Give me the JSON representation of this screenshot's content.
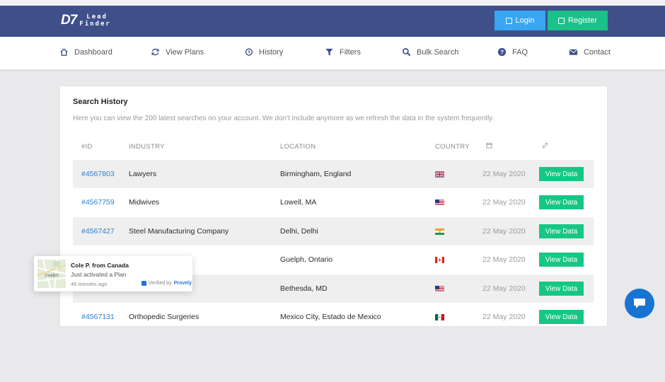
{
  "brand": {
    "mark": "D7",
    "line1": "Lead",
    "line2": "Finder"
  },
  "header": {
    "login_label": "Login",
    "register_label": "Register"
  },
  "nav": {
    "items": [
      {
        "label": "Dashboard",
        "icon": "home-icon"
      },
      {
        "label": "View Plans",
        "icon": "refresh-icon"
      },
      {
        "label": "History",
        "icon": "history-icon"
      },
      {
        "label": "Filters",
        "icon": "filter-icon"
      },
      {
        "label": "Bulk Search",
        "icon": "search-icon"
      },
      {
        "label": "FAQ",
        "icon": "question-icon"
      },
      {
        "label": "Contact",
        "icon": "mail-icon"
      }
    ]
  },
  "card": {
    "title": "Search History",
    "subtitle": "Here you can view the 200 latest searches on your account. We don't include anymore as we refresh the data in the system frequently."
  },
  "table": {
    "headers": {
      "id": "#ID",
      "industry": "INDUSTRY",
      "location": "LOCATION",
      "country": "COUNTRY",
      "date_icon": "calendar-icon",
      "link_icon": "link-icon"
    },
    "rows": [
      {
        "id": "#4567803",
        "industry": "Lawyers",
        "location": "Birmingham, England",
        "country": "uk-flag",
        "date": "22 May 2020",
        "action": "View Data"
      },
      {
        "id": "#4567759",
        "industry": "Midwives",
        "location": "Lowell, MA",
        "country": "us-flag",
        "date": "22 May 2020",
        "action": "View Data"
      },
      {
        "id": "#4567427",
        "industry": "Steel Manufacturing Company",
        "location": "Delhi, Delhi",
        "country": "india-flag",
        "date": "22 May 2020",
        "action": "View Data"
      },
      {
        "id": "",
        "industry": "",
        "location": "Guelph, Ontario",
        "country": "canada-flag",
        "date": "22 May 2020",
        "action": "View Data"
      },
      {
        "id": "",
        "industry": "",
        "location": "Bethesda, MD",
        "country": "us-flag",
        "date": "22 May 2020",
        "action": "View Data"
      },
      {
        "id": "#4567131",
        "industry": "Orthopedic Surgeries",
        "location": "Mexico City, Estado de Mexico",
        "country": "mexico-flag",
        "date": "22 May 2020",
        "action": "View Data"
      }
    ]
  },
  "popup": {
    "map_label": "Guelph",
    "title": "Cole P. from Canada",
    "message": "Just activated a Plan",
    "time": "46 minutes ago",
    "verified_by": "Verified by",
    "verified_brand": "Provely"
  },
  "colors": {
    "header_bg": "#3e4f8a",
    "login": "#3aa5f0",
    "register": "#1bc08a",
    "view_data": "#16c784",
    "id_link": "#2f7fd0",
    "chat": "#1873d3"
  }
}
